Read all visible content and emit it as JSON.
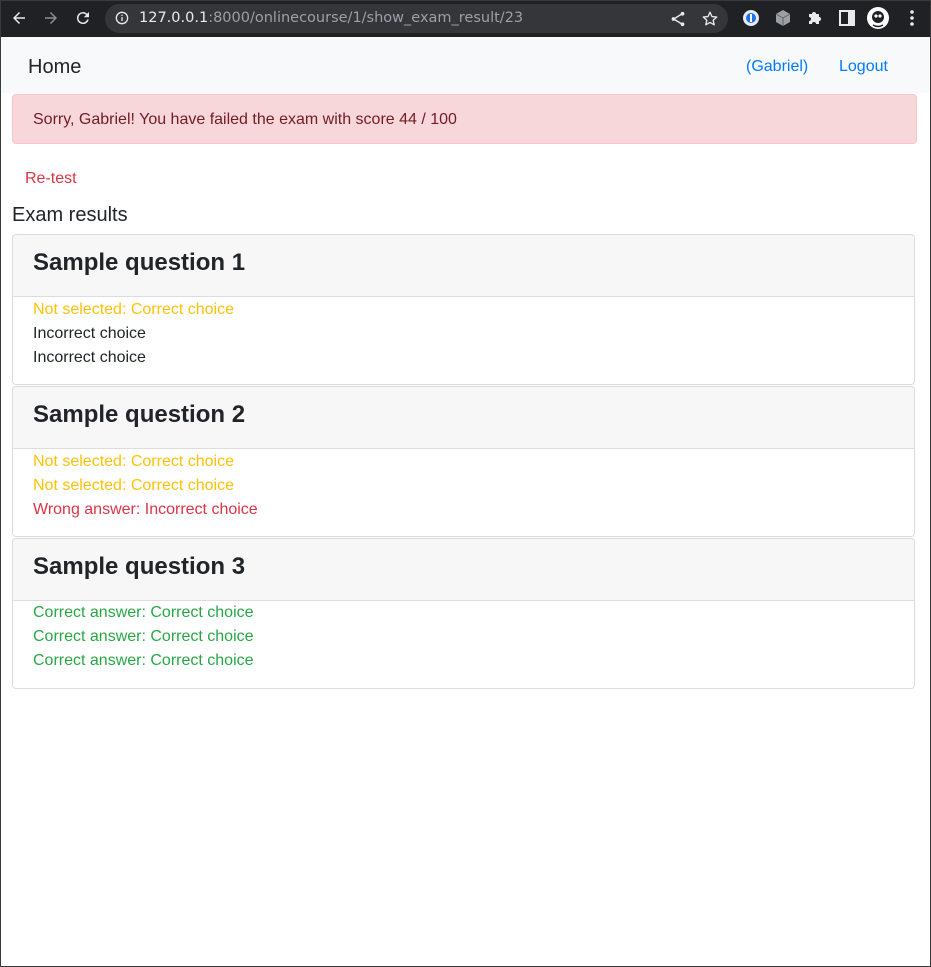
{
  "browser": {
    "url_host": "127.0.0.1",
    "url_rest": ":8000/onlinecourse/1/show_exam_result/23"
  },
  "navbar": {
    "brand": "Home",
    "user_link": "(Gabriel)",
    "logout_link": "Logout"
  },
  "alert": {
    "message": "Sorry, Gabriel! You have failed the exam with score 44 / 100"
  },
  "retest_link": "Re-test",
  "section_title": "Exam results",
  "questions": [
    {
      "title": "Sample question 1",
      "choices": [
        {
          "text": "Not selected: Correct choice",
          "status": "not-selected"
        },
        {
          "text": "Incorrect choice",
          "status": "neutral"
        },
        {
          "text": "Incorrect choice",
          "status": "neutral"
        }
      ]
    },
    {
      "title": "Sample question 2",
      "choices": [
        {
          "text": "Not selected: Correct choice",
          "status": "not-selected"
        },
        {
          "text": "Not selected: Correct choice",
          "status": "not-selected"
        },
        {
          "text": "Wrong answer: Incorrect choice",
          "status": "wrong"
        }
      ]
    },
    {
      "title": "Sample question 3",
      "choices": [
        {
          "text": "Correct answer: Correct choice",
          "status": "correct"
        },
        {
          "text": "Correct answer: Correct choice",
          "status": "correct"
        },
        {
          "text": "Correct answer: Correct choice",
          "status": "correct"
        }
      ]
    }
  ],
  "colors": {
    "not_selected": "#ffc107",
    "neutral": "#212529",
    "wrong": "#dc3545",
    "correct": "#28a745",
    "link": "#007bff",
    "alert_bg": "#f8d7da",
    "alert_text": "#721c24"
  }
}
